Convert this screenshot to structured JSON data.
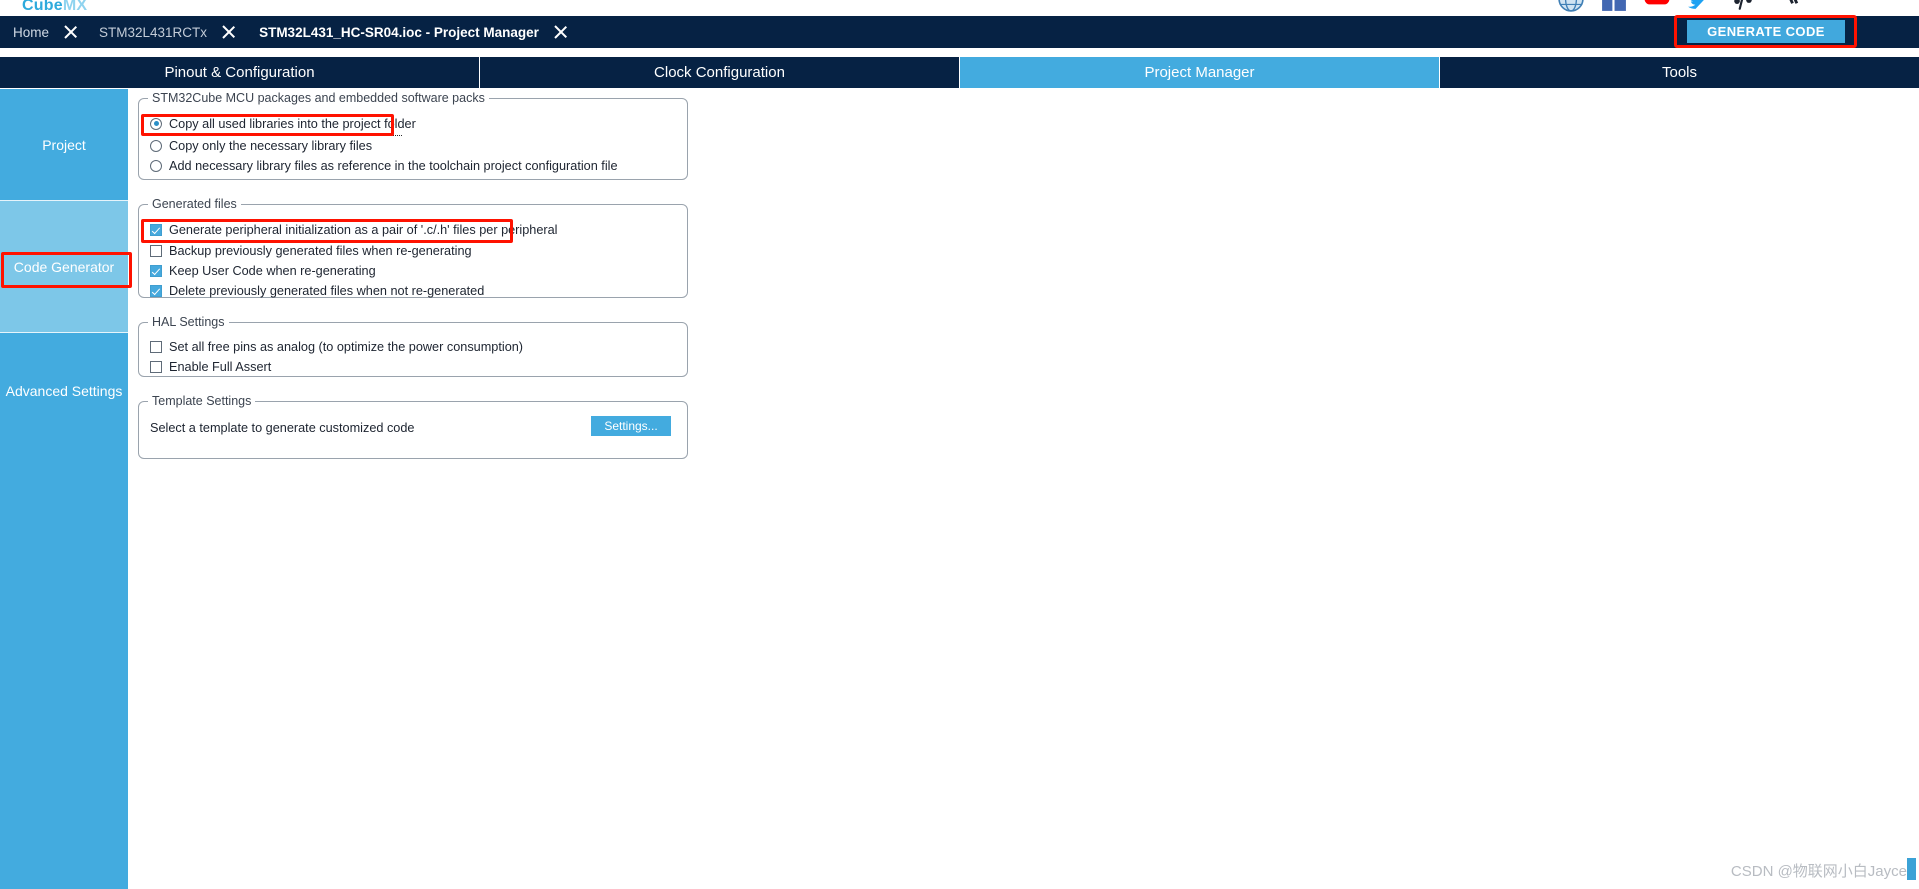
{
  "brand": {
    "part1": "Cube",
    "part2": "MX"
  },
  "social_icons": [
    "globe-icon",
    "facebook-icon",
    "youtube-icon",
    "twitter-icon",
    "ios-icon",
    "android-icon"
  ],
  "breadcrumb": {
    "home": "Home",
    "device": "STM32L431RCTx",
    "current": "STM32L431_HC-SR04.ioc - Project Manager"
  },
  "toolbar": {
    "generate_code_label": "GENERATE CODE",
    "generate_code_bg": "#41a8dd",
    "highlight_color": "#ff1200"
  },
  "tabs": [
    {
      "label": "Pinout & Configuration",
      "selected": false
    },
    {
      "label": "Clock Configuration",
      "selected": false
    },
    {
      "label": "Project Manager",
      "selected": true
    },
    {
      "label": "Tools",
      "selected": false
    }
  ],
  "sidebar": {
    "items": [
      {
        "label": "Project",
        "selected": false
      },
      {
        "label": "Code Generator",
        "selected": true
      },
      {
        "label": "Advanced Settings",
        "selected": false
      },
      {
        "label": "",
        "selected": false
      }
    ]
  },
  "groups": {
    "mcu_packages": {
      "legend": "STM32Cube MCU packages and embedded software packs",
      "options": [
        {
          "label": "Copy all used libraries into the project folder",
          "checked": true,
          "highlighted": true
        },
        {
          "label": "Copy only the necessary library files",
          "checked": false,
          "highlighted": false
        },
        {
          "label": "Add necessary library files as reference in the toolchain project configuration file",
          "checked": false,
          "highlighted": false
        }
      ]
    },
    "generated_files": {
      "legend": "Generated files",
      "options": [
        {
          "label": "Generate peripheral initialization as a pair of '.c/.h' files per peripheral",
          "checked": true,
          "highlighted": true
        },
        {
          "label": "Backup previously generated files when re-generating",
          "checked": false,
          "highlighted": false
        },
        {
          "label": "Keep User Code when re-generating",
          "checked": true,
          "highlighted": false
        },
        {
          "label": "Delete previously generated files when not re-generated",
          "checked": true,
          "highlighted": false
        }
      ]
    },
    "hal_settings": {
      "legend": "HAL Settings",
      "options": [
        {
          "label": "Set all free pins as analog (to optimize the power consumption)",
          "checked": false
        },
        {
          "label": "Enable Full Assert",
          "checked": false
        }
      ]
    },
    "template_settings": {
      "legend": "Template Settings",
      "description": "Select a template to generate customized code",
      "button_label": "Settings..."
    }
  },
  "watermark": "CSDN @物联网小白Jayce",
  "theme": {
    "navy": "#062244",
    "accent": "#43abdf",
    "sidebar_selected": "#7dc7e8"
  }
}
